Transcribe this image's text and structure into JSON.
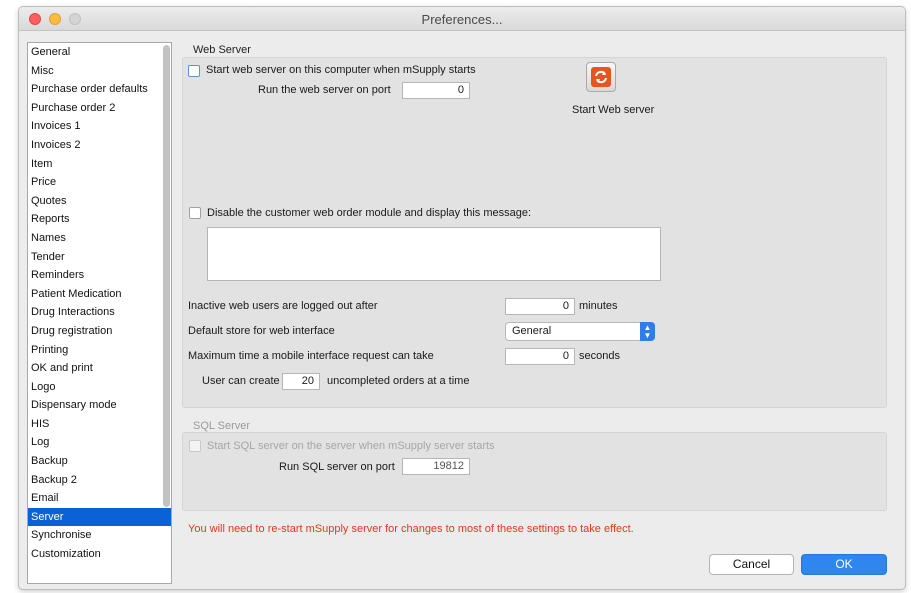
{
  "window": {
    "title": "Preferences..."
  },
  "sidebar": {
    "items": [
      "General",
      "Misc",
      "Purchase order defaults",
      "Purchase order 2",
      "Invoices 1",
      "Invoices 2",
      "Item",
      "Price",
      "Quotes",
      "Reports",
      "Names",
      "Tender",
      "Reminders",
      "Patient Medication",
      "Drug Interactions",
      "Drug registration",
      "Printing",
      "OK and print",
      "Logo",
      "Dispensary mode",
      "HIS",
      "Log",
      "Backup",
      "Backup 2",
      "Email",
      "Server",
      "Synchronise",
      "Customization"
    ],
    "selected": "Server"
  },
  "web_server": {
    "section_title": "Web Server",
    "start_checkbox_label": "Start web server on this computer when mSupply starts",
    "start_checked": false,
    "port_label": "Run the web server on port",
    "port_value": "0",
    "start_button_label": "Start Web server",
    "start_button_icon": "sync-arrows-icon",
    "disable_checkbox_label": "Disable the customer web order module and display this message:",
    "disable_checked": false,
    "message_value": "",
    "inactive_label": "Inactive web users are logged out after",
    "inactive_value": "0",
    "inactive_unit": "minutes",
    "default_store_label": "Default store for web interface",
    "default_store_value": "General",
    "max_time_label": "Maximum time a mobile interface request can take",
    "max_time_value": "0",
    "max_time_unit": "seconds",
    "user_create_label": "User can create",
    "user_create_value": "20",
    "user_create_suffix": "uncompleted orders at a time"
  },
  "sql_server": {
    "section_title": "SQL Server",
    "start_checkbox_label": "Start SQL server on the server when mSupply server starts",
    "start_checked": false,
    "port_label": "Run SQL server on port",
    "port_value": "19812"
  },
  "footer": {
    "warning": "You will need to re-start mSupply server for changes to most of these settings to take effect.",
    "cancel_label": "Cancel",
    "ok_label": "OK"
  },
  "colors": {
    "accent": "#2f86ee",
    "selection": "#0b62d6",
    "warning": "#e03a1a"
  }
}
